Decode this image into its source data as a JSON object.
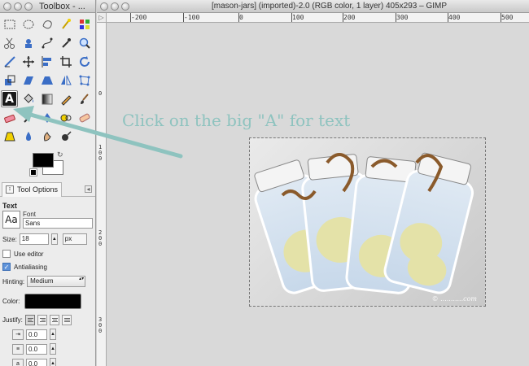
{
  "toolbox": {
    "title": "Toolbox - ...",
    "tools": [
      {
        "name": "rect-select-icon"
      },
      {
        "name": "ellipse-select-icon"
      },
      {
        "name": "free-select-icon"
      },
      {
        "name": "fuzzy-select-icon"
      },
      {
        "name": "select-by-color-icon"
      },
      {
        "name": "scissors-icon"
      },
      {
        "name": "foreground-select-icon"
      },
      {
        "name": "paths-icon"
      },
      {
        "name": "color-picker-icon"
      },
      {
        "name": "zoom-icon"
      },
      {
        "name": "measure-icon"
      },
      {
        "name": "move-icon"
      },
      {
        "name": "align-icon"
      },
      {
        "name": "crop-icon"
      },
      {
        "name": "rotate-icon"
      },
      {
        "name": "scale-icon"
      },
      {
        "name": "shear-icon"
      },
      {
        "name": "perspective-icon"
      },
      {
        "name": "flip-icon"
      },
      {
        "name": "cage-icon"
      },
      {
        "name": "text-tool-icon"
      },
      {
        "name": "bucket-fill-icon"
      },
      {
        "name": "blend-icon"
      },
      {
        "name": "pencil-icon"
      },
      {
        "name": "paintbrush-icon"
      },
      {
        "name": "eraser-icon"
      },
      {
        "name": "airbrush-icon"
      },
      {
        "name": "ink-icon"
      },
      {
        "name": "clone-icon"
      },
      {
        "name": "heal-icon"
      },
      {
        "name": "perspective-clone-icon"
      },
      {
        "name": "blur-icon"
      },
      {
        "name": "smudge-icon"
      },
      {
        "name": "dodge-burn-icon"
      }
    ],
    "active_tool_glyph": "A"
  },
  "tool_options": {
    "tab_label": "Tool Options",
    "section_title": "Text",
    "aa_preview": "Aa",
    "font_label": "Font",
    "font_value": "Sans",
    "size_label": "Size:",
    "size_value": "18",
    "size_unit": "px",
    "use_editor_label": "Use editor",
    "use_editor_checked": false,
    "antialiasing_label": "Antialiasing",
    "antialiasing_checked": true,
    "hinting_label": "Hinting:",
    "hinting_value": "Medium",
    "color_label": "Color:",
    "color_value": "#000000",
    "justify_label": "Justify:",
    "indent_value": "0.0",
    "line_spacing_value": "0.0",
    "letter_spacing_value": "0.0"
  },
  "image_window": {
    "title": "[mason-jars] (imported)-2.0 (RGB color, 1 layer) 405x293 – GIMP",
    "hruler_labels": [
      "-200",
      "-100",
      "0",
      "100",
      "200",
      "300",
      "400",
      "500"
    ],
    "vruler_labels": [
      "0",
      "100",
      "200",
      "300"
    ],
    "watermark": "© ...........com"
  },
  "annotation": {
    "text": "Click on the big \"A\" for text",
    "color": "#8ec3bf"
  }
}
